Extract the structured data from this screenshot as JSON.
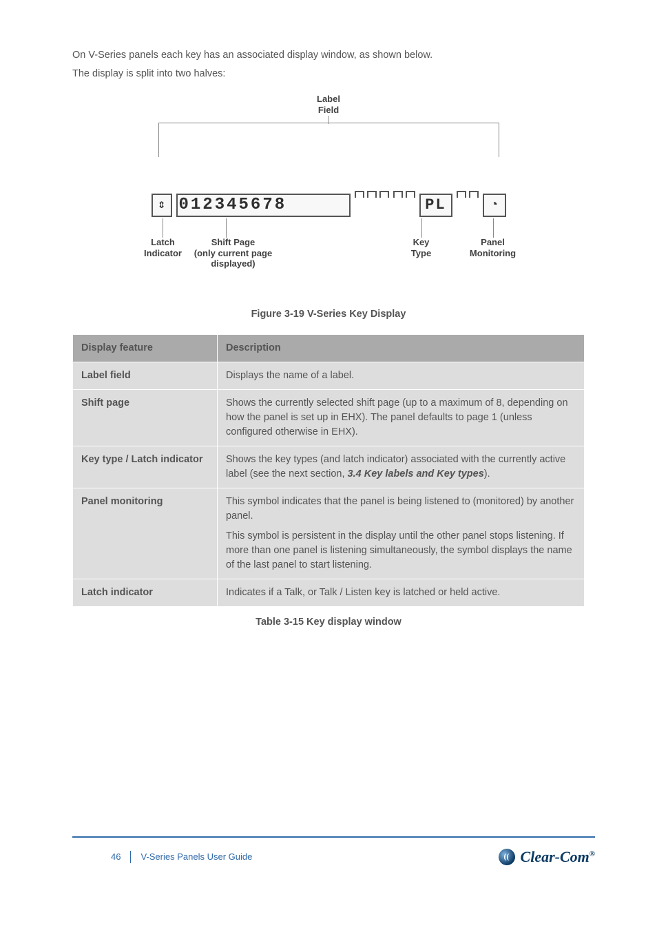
{
  "intro": {
    "p1": "On V-Series panels each key has an associated display window, as shown below.",
    "p2": "The display is split into two halves:"
  },
  "figure": {
    "top_label_line1": "Label",
    "top_label_line2": "Field",
    "display_text": "012345678",
    "keytype_text": "PL",
    "latch_label_line1": "Latch",
    "latch_label_line2": "Indicator",
    "shift_label_line1": "Shift Page",
    "shift_label_line2": "(only current page",
    "shift_label_line3": "displayed)",
    "keytype_label_line1": "Key",
    "keytype_label_line2": "Type",
    "mon_label_line1": "Panel",
    "mon_label_line2": "Monitoring",
    "caption": "Figure 3-19 V-Series Key Display"
  },
  "table": {
    "head_col1": "Display feature",
    "head_col2": "Description",
    "rows": [
      {
        "term": "Label field",
        "desc_parts": [
          "Displays the name of a label."
        ]
      },
      {
        "term": "Shift page",
        "desc_parts": [
          "Shows the currently selected shift page (up to a maximum of 8, depending on how the panel is set up in EHX). The panel defaults to page 1 (unless configured otherwise in EHX)."
        ]
      },
      {
        "term": "Key type / Latch indicator",
        "desc_parts": [
          "Shows the key types (and latch indicator) associated with the currently active label (see the next section, ",
          " ",
          ")."
        ],
        "link": "3.4 Key labels and Key types"
      },
      {
        "term": "Panel monitoring",
        "desc_parts": [
          "This symbol indicates that the panel is being listened to (monitored) by another panel.",
          "This symbol is persistent in the display until the other panel stops listening. If more than one panel is listening simultaneously, the symbol displays the name of the last panel to start listening."
        ]
      },
      {
        "term": "Latch indicator",
        "desc_parts": [
          "Indicates if a Talk, or Talk / Listen key is latched or held active."
        ]
      }
    ],
    "caption": "Table 3-15 Key display window"
  },
  "footer": {
    "page": "46",
    "doc": "V-Series Panels User Guide",
    "brand": "Clear-Com",
    "reg": "®"
  }
}
